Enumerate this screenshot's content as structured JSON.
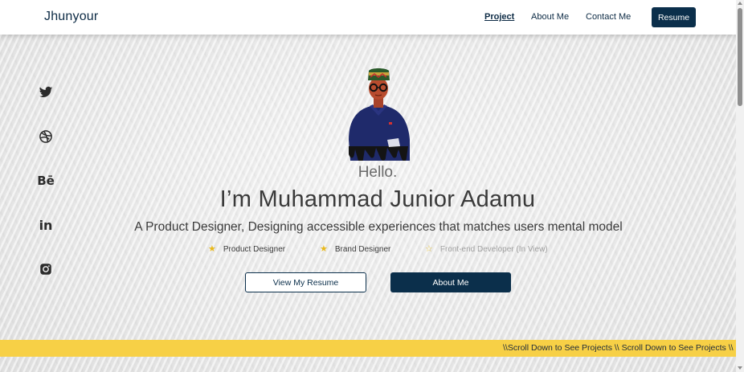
{
  "navbar": {
    "brand": "Jhunyour",
    "links": [
      "Project",
      "About Me",
      "Contact Me"
    ],
    "resume_label": "Resume"
  },
  "social": [
    "twitter-icon",
    "dribbble-icon",
    "behance-icon",
    "linkedin-icon",
    "instagram-icon"
  ],
  "social_labels": {
    "behance": "Bē",
    "linkedin": "in"
  },
  "hero": {
    "greeting": "Hello.",
    "name": "I’m Muhammad Junior Adamu",
    "tagline": "A Product Designer, Designing accessible experiences that matches users mental model",
    "roles": [
      {
        "label": "Product Designer",
        "star": "★"
      },
      {
        "label": "Brand Designer",
        "star": "★"
      },
      {
        "label": "Front-end Developer (In View)",
        "star": "☆"
      }
    ],
    "view_resume_label": "View My Resume",
    "about_label": "About Me"
  },
  "marquee": {
    "text": "\\\\Scroll Down to See Projects \\\\ Scroll Down to See Projects \\\\ Scroll Down to See Projects"
  },
  "colors": {
    "primary": "#0b2f4b",
    "accent": "#f7d046",
    "star": "#e8b81a"
  }
}
